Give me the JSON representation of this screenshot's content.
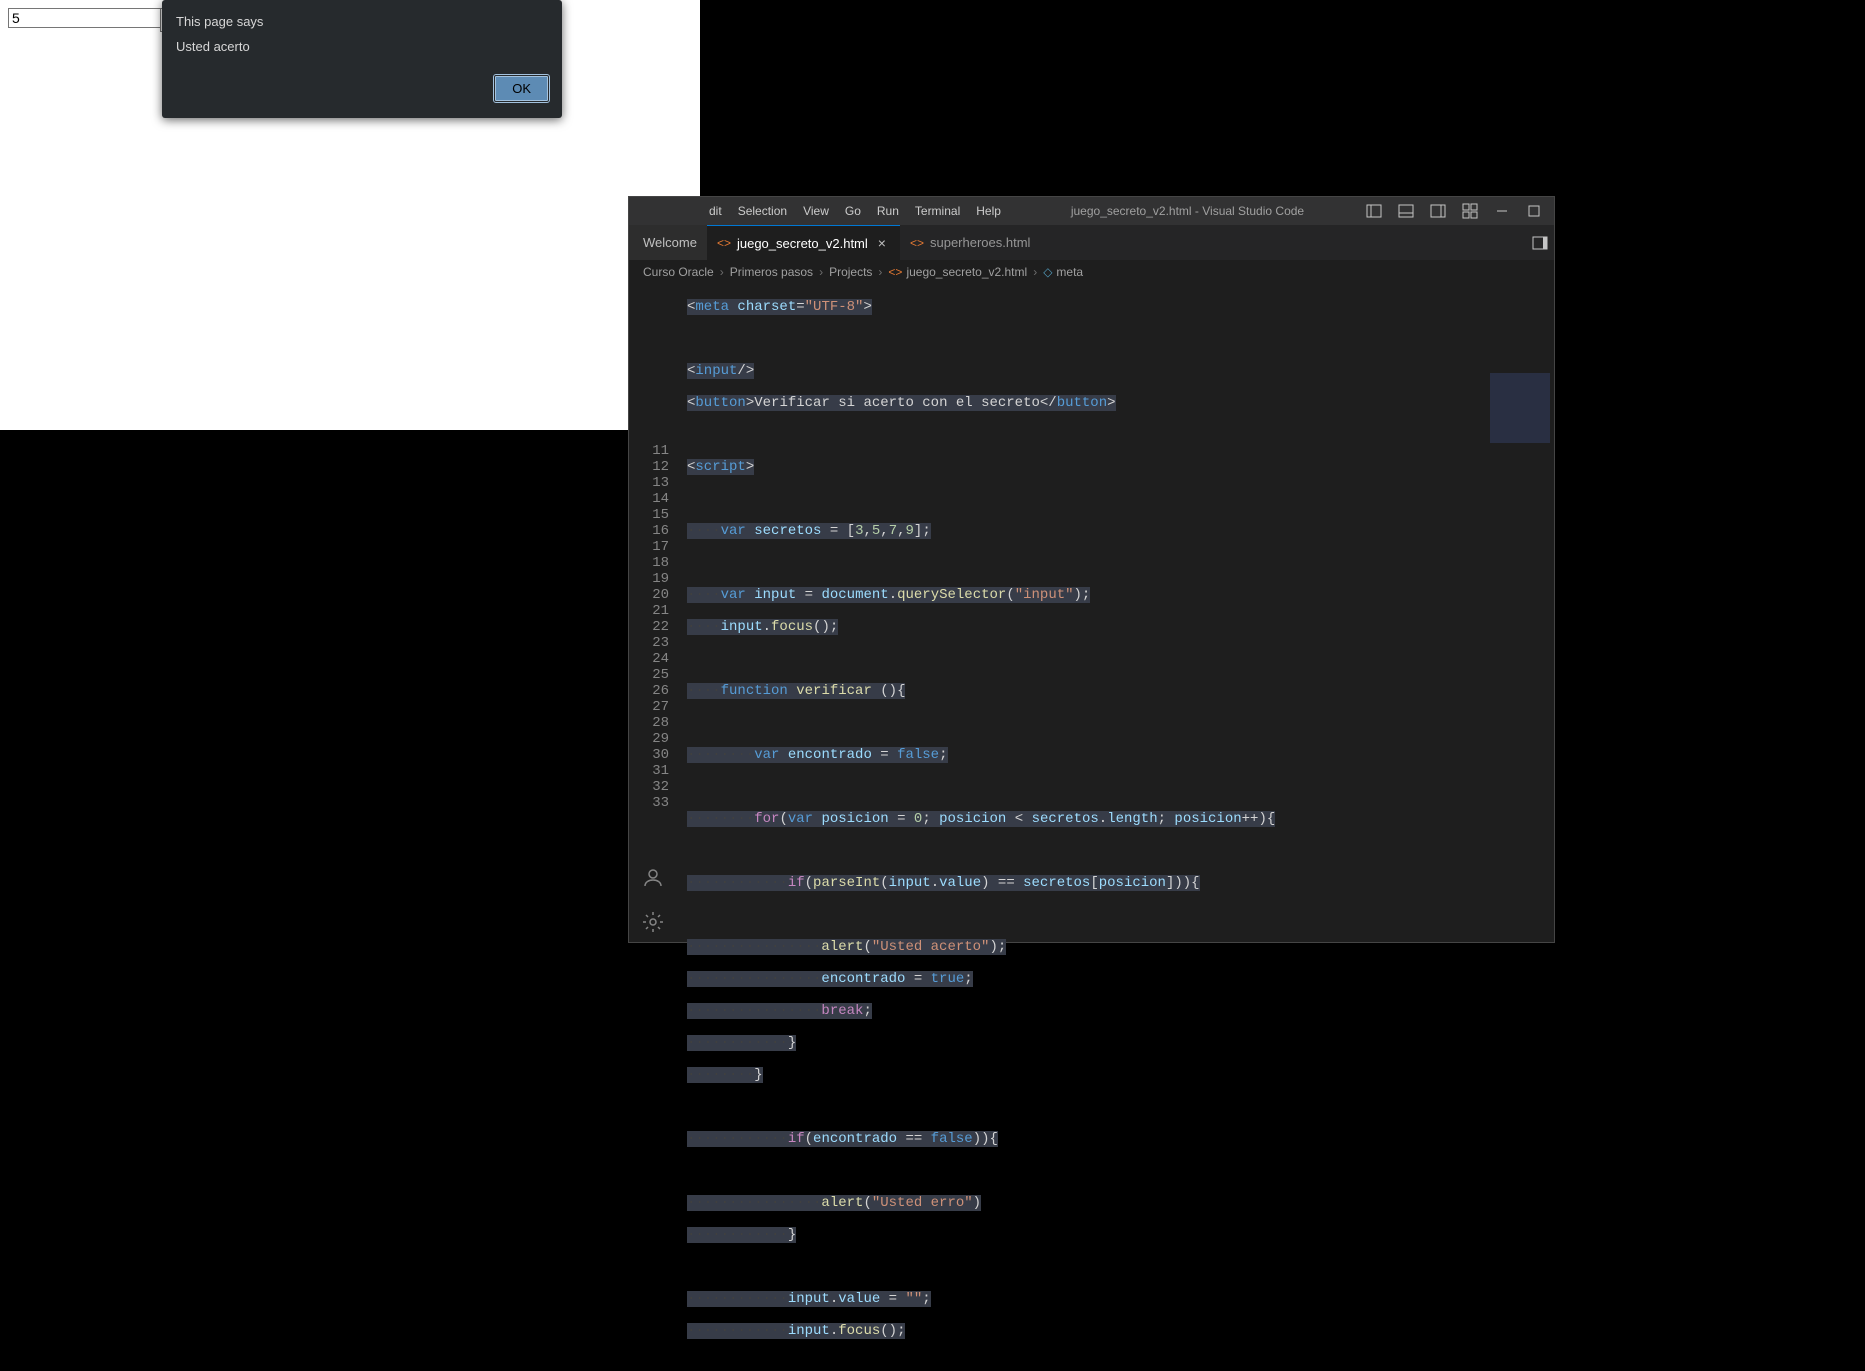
{
  "browser": {
    "input_value": "5"
  },
  "alert": {
    "title": "This page says",
    "message": "Usted acerto",
    "ok": "OK"
  },
  "vscode": {
    "menu": {
      "edit": "dit",
      "selection": "Selection",
      "view": "View",
      "go": "Go",
      "run": "Run",
      "terminal": "Terminal",
      "help": "Help"
    },
    "title": "juego_secreto_v2.html - Visual Studio Code",
    "tabs": {
      "welcome": "Welcome",
      "active": "juego_secreto_v2.html",
      "other": "superheroes.html"
    },
    "breadcrumb": {
      "p1": "Curso Oracle",
      "p2": "Primeros pasos",
      "p3": "Projects",
      "file": "juego_secreto_v2.html",
      "symbol": "meta"
    },
    "gutter": [
      "",
      "",
      "",
      "",
      "",
      "",
      "",
      "",
      "",
      "",
      "11",
      "12",
      "13",
      "14",
      "15",
      "16",
      "17",
      "18",
      "19",
      "20",
      "21",
      "22",
      "23",
      "24",
      "25",
      "26",
      "27",
      "28",
      "29",
      "30",
      "31",
      "32",
      "33"
    ],
    "code": {
      "l1a": "<",
      "l1b": "meta ",
      "l1c": "charset",
      "l1d": "=",
      "l1e": "\"UTF-8\"",
      "l1f": ">",
      "l3a": "<",
      "l3b": "input",
      "l3c": "/>",
      "l4a": "<",
      "l4b": "button",
      "l4c": ">",
      "l4d": "Verificar si acerto con el secreto",
      "l4e": "</",
      "l4f": "button",
      "l4g": ">",
      "l6a": "<",
      "l6b": "script",
      "l6c": ">",
      "ws4": "····",
      "ws8": "········",
      "ws12": "············",
      "ws16": "················",
      "var": "var",
      "function": "function",
      "for": "for",
      "if": "if",
      "true": "true",
      "false": "false",
      "break": "break",
      "secretos": "secretos",
      "eq": " = ",
      "arr": "[",
      "a1": "3",
      "ac": ",",
      "a2": "5",
      "a3": "7",
      "a4": "9",
      "arre": "];",
      "input": "input",
      "doc": "document",
      "qs": "querySelector",
      "istr": "\"input\"",
      ")": ");",
      "focus": "focus",
      "p": "();",
      "verificar": "verificar",
      "pp": " (){",
      "encontrado": "encontrado",
      "f": ";",
      "posicion": "posicion",
      "z": "0",
      "lt": " < ",
      "len": "length",
      "pi": "++){",
      "sc": "; ",
      "parseInt": "parseInt",
      "value": "value",
      "eqq": " == ",
      "ob": "[",
      "cb": "]",
      "ocb": "){",
      "alert": "alert",
      "ua": "\"Usted acerto\"",
      "ue": "\"Usted erro\"",
      "cbr": "}",
      "emptystr": "\"\"",
      "semici": ";",
      "dot": ".",
      "open": "(",
      "close": ")",
      "comma": ",",
      "colon": ": "
    }
  }
}
